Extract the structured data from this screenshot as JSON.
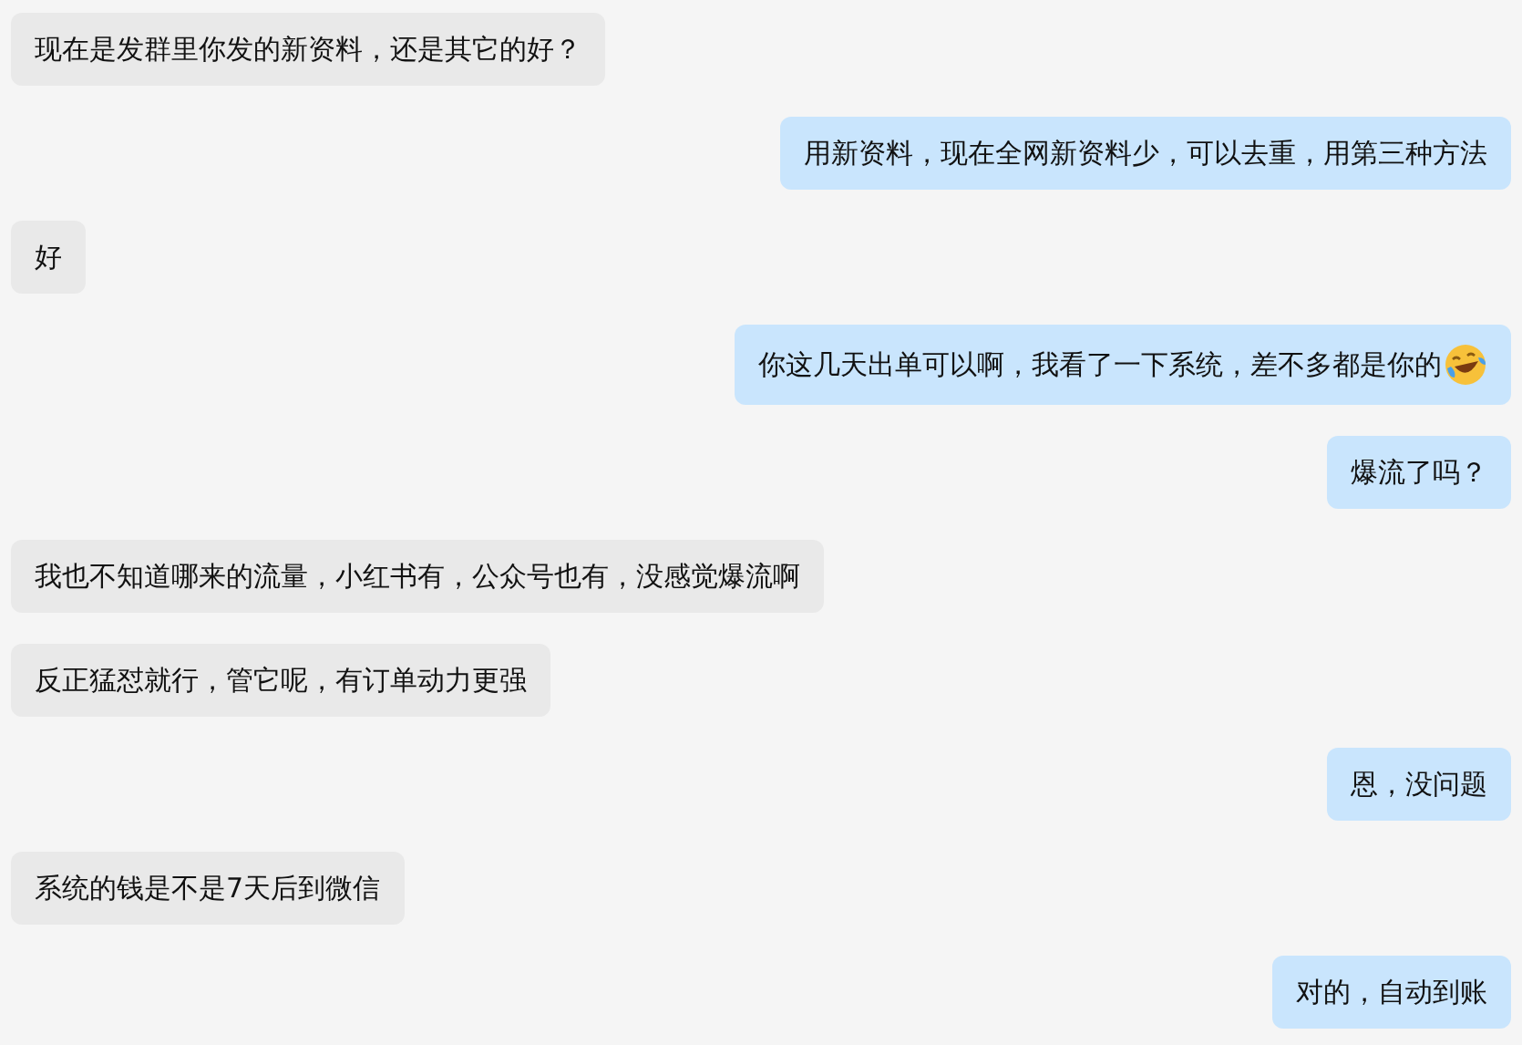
{
  "messages": [
    {
      "kind": "received",
      "text": "现在是发群里你发的新资料，还是其它的好？"
    },
    {
      "kind": "sent",
      "text": "用新资料，现在全网新资料少，可以去重，用第三种方法"
    },
    {
      "kind": "received",
      "text": "好"
    },
    {
      "kind": "sent",
      "text": "你这几天出单可以啊，我看了一下系统，差不多都是你的",
      "emoji": true
    },
    {
      "kind": "sent",
      "text": "爆流了吗？"
    },
    {
      "kind": "received",
      "text": "我也不知道哪来的流量，小红书有，公众号也有，没感觉爆流啊"
    },
    {
      "kind": "received",
      "text": "反正猛怼就行，管它呢，有订单动力更强"
    },
    {
      "kind": "sent",
      "text": "恩，没问题"
    },
    {
      "kind": "received",
      "text": "系统的钱是不是7天后到微信"
    },
    {
      "kind": "sent",
      "text": "对的，自动到账"
    }
  ]
}
